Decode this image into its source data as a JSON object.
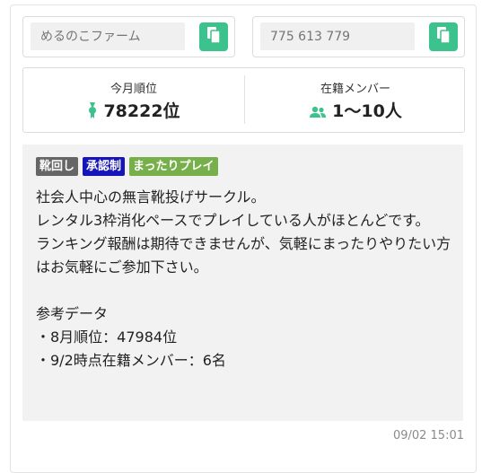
{
  "circle": {
    "name_placeholder": "めるのこファーム",
    "id_placeholder": "775 613 779"
  },
  "stats": {
    "rank_label": "今月順位",
    "rank_value": "78222位",
    "members_label": "在籍メンバー",
    "members_value": "1〜10人"
  },
  "tags": [
    {
      "label": "靴回し",
      "color": "#666666"
    },
    {
      "label": "承認制",
      "color": "#1515b8"
    },
    {
      "label": "まったりプレイ",
      "color": "#77b04a"
    }
  ],
  "description": "社会人中心の無言靴投げサークル。\nレンタル3枠消化ペースでプレイしている人がほとんどです。\nランキング報酬は期待できませんが、気軽にまったりやりたい方はお気軽にご参加下さい。\n\n参考データ\n・8月順位：47984位\n・9/2時点在籍メンバー：6名",
  "timestamp": "09/02 15:01",
  "colors": {
    "accent": "#3cc28c",
    "panel_bg": "#f2f2f2"
  },
  "icons": {
    "copy": "copy-icon",
    "rank": "medal-icon",
    "members": "users-icon"
  }
}
